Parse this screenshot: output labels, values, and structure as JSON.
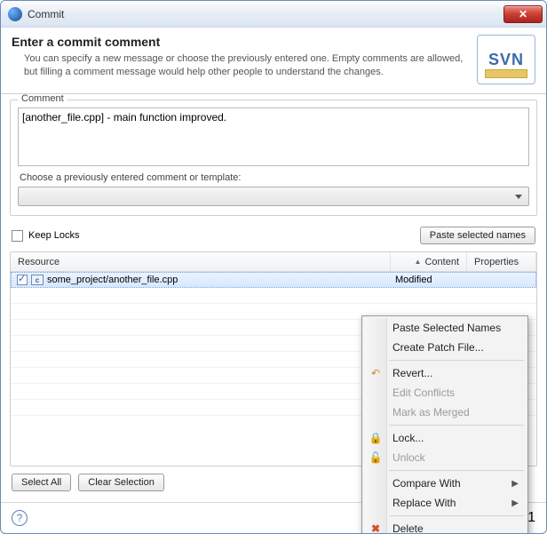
{
  "window": {
    "title": "Commit"
  },
  "header": {
    "title": "Enter a commit comment",
    "desc": "You can specify a new message or choose the previously entered one. Empty comments are allowed, but filling a comment message would help other people to understand the changes.",
    "logo_text": "SVN"
  },
  "comment": {
    "legend": "Comment",
    "value": "[another_file.cpp] - main function improved.",
    "prev_label": "Choose a previously entered comment or template:"
  },
  "options": {
    "keep_locks": "Keep Locks",
    "paste_names": "Paste selected names"
  },
  "table": {
    "cols": {
      "resource": "Resource",
      "content": "Content",
      "properties": "Properties"
    },
    "rows": [
      {
        "checked": true,
        "path": "some_project/another_file.cpp",
        "content": "Modified"
      }
    ]
  },
  "buttons": {
    "select_all": "Select All",
    "clear_sel": "Clear Selection"
  },
  "footer": {
    "count": "1"
  },
  "menu": {
    "paste": "Paste Selected Names",
    "patch": "Create Patch File...",
    "revert": "Revert...",
    "edit_conf": "Edit Conflicts",
    "mark_merged": "Mark as Merged",
    "lock": "Lock...",
    "unlock": "Unlock",
    "compare": "Compare With",
    "replace": "Replace With",
    "delete": "Delete"
  }
}
